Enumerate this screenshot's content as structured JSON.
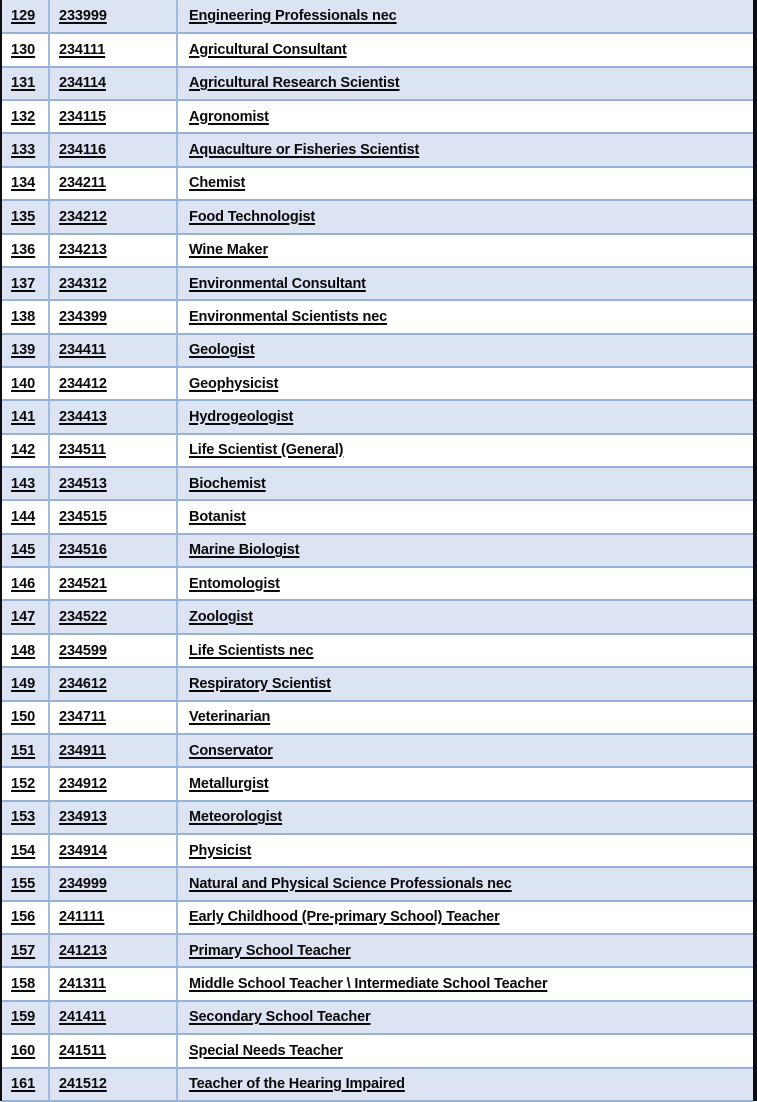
{
  "table": {
    "name": "occupation-code-list",
    "columns": [
      {
        "key": "index",
        "header": ""
      },
      {
        "key": "code",
        "header": ""
      },
      {
        "key": "title",
        "header": ""
      }
    ],
    "colors": {
      "row_shaded_background": "#dce3f2",
      "row_plain_background": "#ffffff",
      "cell_border": "#95b3d7",
      "column_divider": "#a3b9dd",
      "outer_frame": "#0d0d12",
      "text": "#0a0a0a"
    },
    "rows": [
      {
        "index": "129",
        "code": "233999",
        "title": "Engineering Professionals nec"
      },
      {
        "index": "130",
        "code": "234111",
        "title": "Agricultural Consultant"
      },
      {
        "index": "131",
        "code": "234114",
        "title": "Agricultural Research Scientist"
      },
      {
        "index": "132",
        "code": "234115",
        "title": "Agronomist"
      },
      {
        "index": "133",
        "code": "234116",
        "title": "Aquaculture or Fisheries Scientist"
      },
      {
        "index": "134",
        "code": "234211",
        "title": "Chemist"
      },
      {
        "index": "135",
        "code": "234212",
        "title": "Food Technologist"
      },
      {
        "index": "136",
        "code": "234213",
        "title": "Wine Maker"
      },
      {
        "index": "137",
        "code": "234312",
        "title": "Environmental Consultant"
      },
      {
        "index": "138",
        "code": "234399",
        "title": "Environmental Scientists nec"
      },
      {
        "index": "139",
        "code": "234411",
        "title": "Geologist"
      },
      {
        "index": "140",
        "code": "234412",
        "title": "Geophysicist"
      },
      {
        "index": "141",
        "code": "234413",
        "title": "Hydrogeologist"
      },
      {
        "index": "142",
        "code": "234511",
        "title": "Life Scientist (General)"
      },
      {
        "index": "143",
        "code": "234513",
        "title": "Biochemist"
      },
      {
        "index": "144",
        "code": "234515",
        "title": "Botanist"
      },
      {
        "index": "145",
        "code": "234516",
        "title": "Marine Biologist"
      },
      {
        "index": "146",
        "code": "234521",
        "title": "Entomologist"
      },
      {
        "index": "147",
        "code": "234522",
        "title": "Zoologist"
      },
      {
        "index": "148",
        "code": "234599",
        "title": "Life Scientists nec"
      },
      {
        "index": "149",
        "code": "234612",
        "title": "Respiratory Scientist"
      },
      {
        "index": "150",
        "code": "234711",
        "title": "Veterinarian"
      },
      {
        "index": "151",
        "code": "234911",
        "title": "Conservator"
      },
      {
        "index": "152",
        "code": "234912",
        "title": "Metallurgist"
      },
      {
        "index": "153",
        "code": "234913",
        "title": "Meteorologist"
      },
      {
        "index": "154",
        "code": "234914",
        "title": "Physicist"
      },
      {
        "index": "155",
        "code": "234999",
        "title": "Natural and Physical Science Professionals nec"
      },
      {
        "index": "156",
        "code": "241111",
        "title": "Early Childhood (Pre-primary School) Teacher"
      },
      {
        "index": "157",
        "code": "241213",
        "title": "Primary School Teacher"
      },
      {
        "index": "158",
        "code": "241311",
        "title": "Middle School Teacher \\ Intermediate School Teacher"
      },
      {
        "index": "159",
        "code": "241411",
        "title": "Secondary School Teacher"
      },
      {
        "index": "160",
        "code": "241511",
        "title": "Special Needs Teacher"
      },
      {
        "index": "161",
        "code": "241512",
        "title": "Teacher of the Hearing Impaired"
      }
    ]
  }
}
